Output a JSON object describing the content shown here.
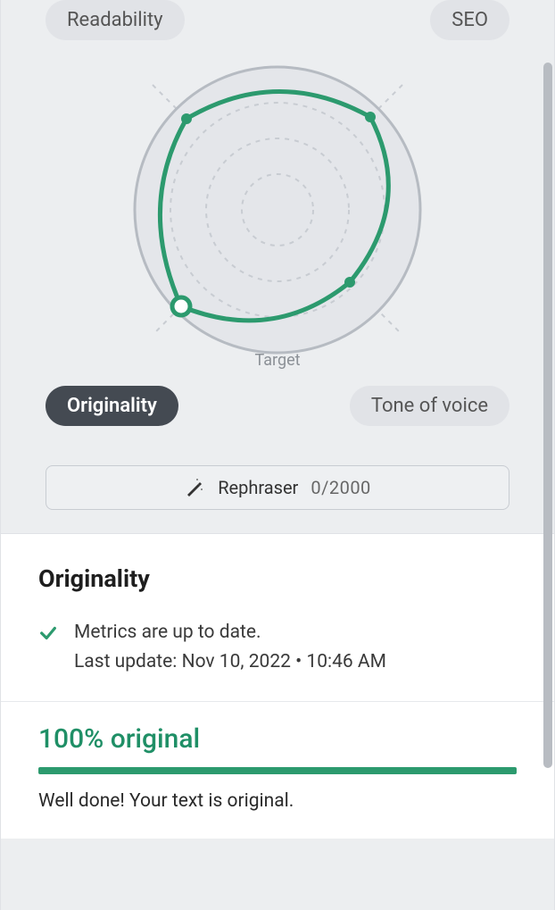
{
  "tabs": {
    "readability": "Readability",
    "seo": "SEO",
    "originality": "Originality",
    "tone": "Tone of voice"
  },
  "chart": {
    "target_label": "Target"
  },
  "chart_data": {
    "type": "radar",
    "title": "",
    "categories": [
      "Readability",
      "SEO",
      "Tone of voice",
      "Originality"
    ],
    "values": [
      0.9,
      0.92,
      0.72,
      0.95
    ],
    "target": [
      1.0,
      1.0,
      1.0,
      1.0
    ],
    "max": 1.0,
    "rings": 4
  },
  "rephraser": {
    "label": "Rephraser",
    "count": "0/2000"
  },
  "section": {
    "title": "Originality",
    "status_line1": "Metrics are up to date.",
    "status_line2": "Last update: Nov 10, 2022 • 10:46 AM"
  },
  "result": {
    "headline": "100% original",
    "message": "Well done! Your text is original."
  },
  "colors": {
    "accent": "#2c9a6e"
  }
}
